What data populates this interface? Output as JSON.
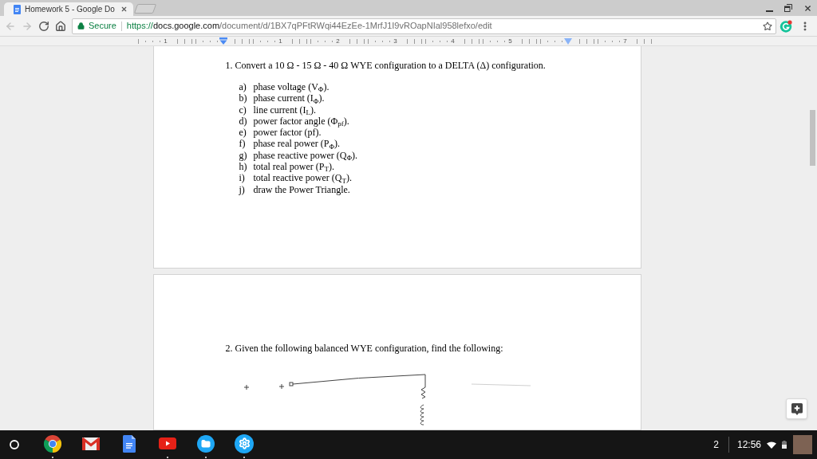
{
  "browser": {
    "tab": {
      "title": "Homework 5 - Google Do"
    },
    "nav_buttons": [
      {
        "kind": "back",
        "disabled": true
      },
      {
        "kind": "forward",
        "disabled": true
      },
      {
        "kind": "reload",
        "disabled": false
      },
      {
        "kind": "home",
        "disabled": false
      }
    ],
    "omnibox": {
      "security_label": "Secure",
      "url": {
        "scheme": "https://",
        "host": "docs.google.com",
        "path": "/document/d/1BX7qPFtRWqi44EzEe-1MrfJ1I9vROapNIal958lefxo/edit"
      }
    }
  },
  "ruler": {
    "marks": [
      {
        "kind": "number",
        "label": "1"
      },
      {
        "kind": "left-indent"
      },
      {
        "kind": "number",
        "label": "1"
      },
      {
        "kind": "number",
        "label": "2"
      },
      {
        "kind": "number",
        "label": "3"
      },
      {
        "kind": "number",
        "label": "4"
      },
      {
        "kind": "number",
        "label": "5"
      },
      {
        "kind": "right-indent"
      },
      {
        "kind": "number",
        "label": "7"
      }
    ]
  },
  "document": {
    "pages": [
      {
        "blocks": [
          {
            "kind": "paragraph",
            "text": "1. Convert a 10 Ω - 15 Ω - 40 Ω WYE configuration to a DELTA (Δ) configuration."
          },
          {
            "kind": "list",
            "items": [
              {
                "marker": "a)",
                "text": "phase voltage (V$_{Φ}$)."
              },
              {
                "marker": "b)",
                "text": "phase current (I$_{Φ}$)."
              },
              {
                "marker": "c)",
                "text": "line current (I$_{L}$)."
              },
              {
                "marker": "d)",
                "text": "power factor angle (Φ$_{pf}$)."
              },
              {
                "marker": "e)",
                "text": "power factor (pf)."
              },
              {
                "marker": "f)",
                "text": "phase real power (P$_{Φ}$)."
              },
              {
                "marker": "g)",
                "text": "phase reactive power (Q$_{Φ}$)."
              },
              {
                "marker": "h)",
                "text": "total real power (P$_{T}$)."
              },
              {
                "marker": "i)",
                "text": "total reactive power (Q$_{T}$)."
              },
              {
                "marker": "j)",
                "text": "draw the Power Triangle."
              }
            ]
          }
        ]
      },
      {
        "blocks": [
          {
            "kind": "paragraph",
            "text": "2. Given the following balanced WYE configuration, find the following:"
          },
          {
            "kind": "sketch"
          }
        ]
      }
    ]
  },
  "taskbar": {
    "apps": [
      {
        "kind": "browser",
        "running": true
      },
      {
        "kind": "mail",
        "running": false
      },
      {
        "kind": "docs",
        "running": false
      },
      {
        "kind": "video",
        "running": true
      },
      {
        "kind": "files",
        "running": true
      },
      {
        "kind": "settings",
        "running": true
      }
    ],
    "notification_count": "2",
    "time": "12:56"
  }
}
